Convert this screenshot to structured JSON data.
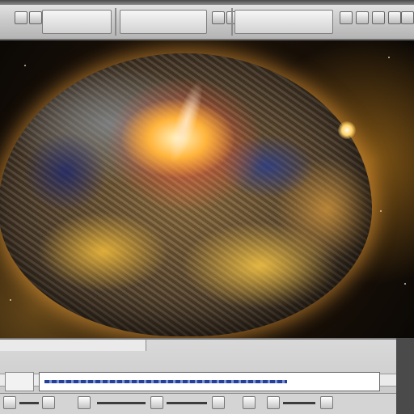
{
  "window": {
    "title": ""
  },
  "toolbar": {
    "groups": [
      "",
      "",
      ""
    ],
    "icons": [
      "",
      "",
      "",
      "",
      "",
      "",
      "",
      "",
      ""
    ]
  },
  "viewport": {
    "content": ""
  },
  "panel": {
    "title": "",
    "path_value": "",
    "size_value": ""
  },
  "statusbar": {
    "buttons": [
      "",
      "",
      "",
      "",
      "",
      "",
      "",
      ""
    ]
  },
  "colors": {
    "accent": "#1c2f7a",
    "chrome": "#c9c9c9",
    "space": "#1a1108",
    "glow": "#ffb43c"
  }
}
